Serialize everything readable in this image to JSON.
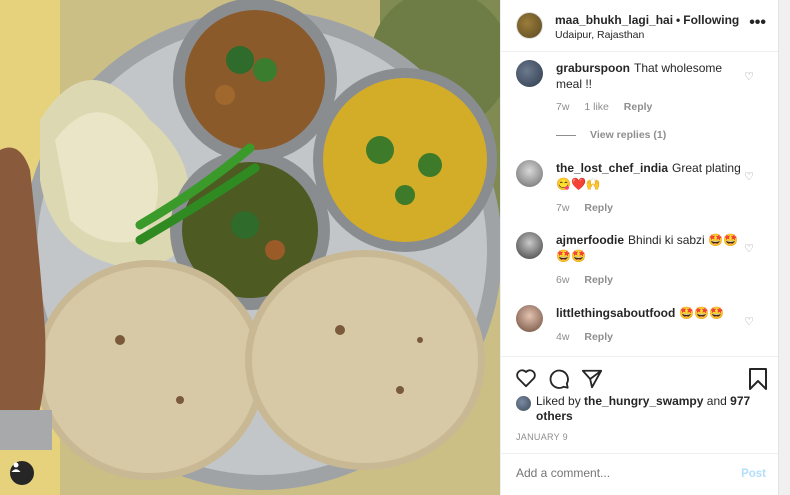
{
  "post": {
    "username": "maa_bhukh_lagi_hai",
    "follow_status": "Following",
    "location": "Udaipur, Rajasthan",
    "more_icon": "more-options-icon"
  },
  "comments": [
    {
      "username": "graburspoon",
      "text": "That wholesome meal !!",
      "age": "7w",
      "likes": "1 like",
      "reply": "Reply",
      "view_replies": "View replies (1)"
    },
    {
      "username": "the_lost_chef_india",
      "text": "Great plating 😋❤️🙌",
      "age": "7w",
      "reply": "Reply"
    },
    {
      "username": "ajmerfoodie",
      "text": "Bhindi ki sabzi 🤩🤩🤩🤩",
      "age": "6w",
      "reply": "Reply"
    },
    {
      "username": "littlethingsaboutfood",
      "text": "🤩🤩🤩",
      "age": "4w",
      "reply": "Reply"
    }
  ],
  "likes": {
    "prefix": "Liked by",
    "user": "the_hungry_swampy",
    "and": "and",
    "others": "977 others"
  },
  "date": "JANUARY 9",
  "add_comment": {
    "placeholder": "Add a comment...",
    "post_label": "Post"
  },
  "colors": {
    "link_blue_disabled": "#b2dffc",
    "muted_text": "#8e8e8e"
  }
}
